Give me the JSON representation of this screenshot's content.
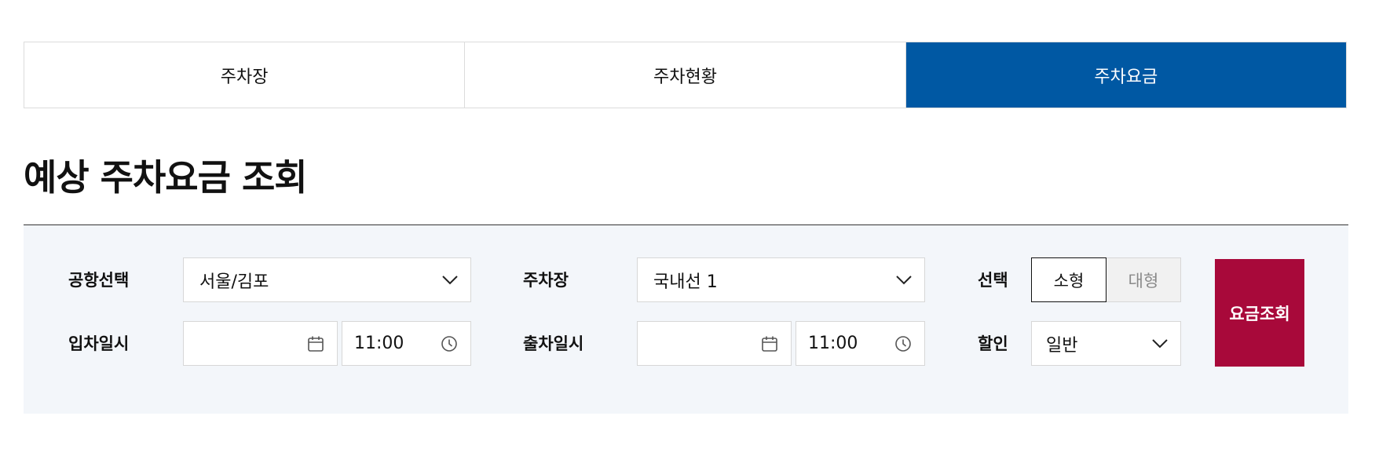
{
  "tabs": [
    {
      "label": "주차장",
      "active": false
    },
    {
      "label": "주차현황",
      "active": false
    },
    {
      "label": "주차요금",
      "active": true
    }
  ],
  "page_title": "예상 주차요금 조회",
  "form": {
    "airport": {
      "label": "공항선택",
      "value": "서울/김포"
    },
    "parking": {
      "label": "주차장",
      "value": "국내선 1"
    },
    "car_size": {
      "label": "선택",
      "options": [
        "소형",
        "대형"
      ],
      "selected": "소형"
    },
    "entry": {
      "label": "입차일시",
      "date": "",
      "time": "11:00"
    },
    "exit": {
      "label": "출차일시",
      "date": "",
      "time": "11:00"
    },
    "discount": {
      "label": "할인",
      "value": "일반"
    },
    "search_button": "요금조회"
  },
  "colors": {
    "active_tab": "#0058a3",
    "search_button": "#a8093a",
    "form_bg": "#f3f6fa"
  },
  "icons": [
    "chevron-down-icon",
    "calendar-icon",
    "clock-icon"
  ]
}
